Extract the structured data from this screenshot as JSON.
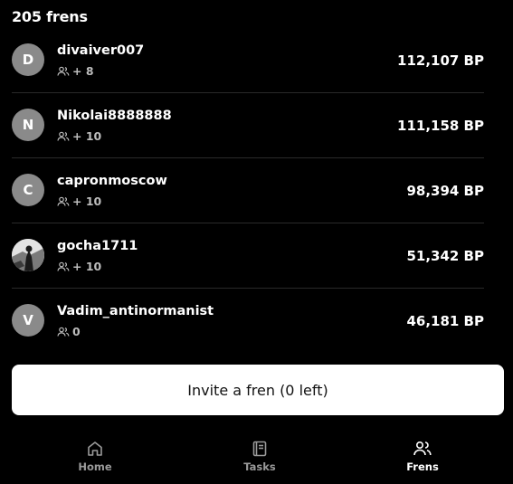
{
  "header": {
    "title": "205 frens"
  },
  "frens": [
    {
      "initial": "D",
      "name": "divaiver007",
      "invited": "+ 8",
      "points": "112,107 BP"
    },
    {
      "initial": "N",
      "name": "Nikolai8888888",
      "invited": "+ 10",
      "points": "111,158 BP"
    },
    {
      "initial": "C",
      "name": "capronmoscow",
      "invited": "+ 10",
      "points": "98,394 BP"
    },
    {
      "initial": "",
      "name": "gocha1711",
      "invited": "+ 10",
      "points": "51,342 BP"
    },
    {
      "initial": "V",
      "name": "Vadim_antinormanist",
      "invited": "0",
      "points": "46,181 BP"
    }
  ],
  "invite_button": {
    "label": "Invite a fren (0 left)"
  },
  "nav": {
    "home": "Home",
    "tasks": "Tasks",
    "frens": "Frens"
  },
  "colors": {
    "background": "#000000",
    "avatar": "#8a8a8a",
    "button": "#ffffff",
    "muted": "#9a9a9a"
  }
}
